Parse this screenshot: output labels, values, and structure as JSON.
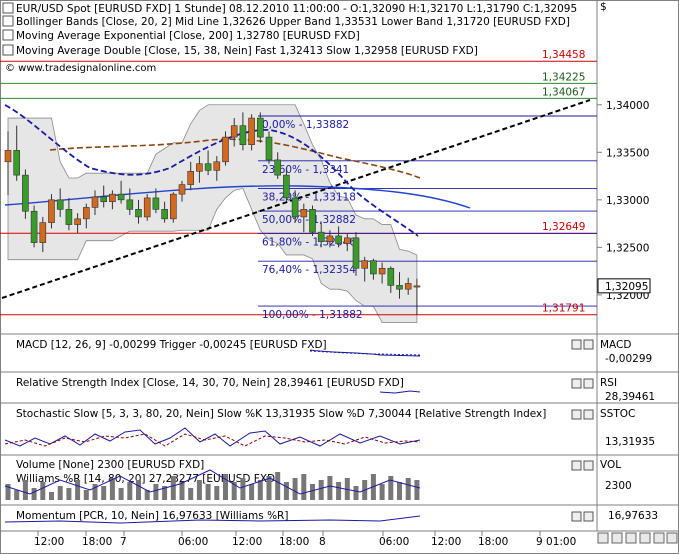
{
  "colors": {
    "bull": "#d2691e",
    "bear": "#3a9a2a",
    "fib": "#1a1aa8",
    "ma_double": "#1a1aa8",
    "ma_slow": "#8b4513",
    "ema200": "#2244cc",
    "trend": "#000000",
    "bands": "#555555",
    "red": "#d10000",
    "green_line": "#2e8b2e",
    "panel_line": "#1a1aa8"
  },
  "header": {
    "title_line": "EUR/USD Spot [EURUSD FXD]  1 Stunde] 08.12.2010 11:00:00 - O:1,32090 H:1,32170 L:1,31790 C:1,32095",
    "bollinger": "Bollinger Bands [Close, 20, 2] Mid Line 1,32626 Upper Band 1,33531 Lower Band 1,31720 [EURUSD FXD]",
    "ema": "Moving Average Exponential [Close, 200] 1,32780 [EURUSD FXD]",
    "ma_double": "Moving Average Double [Close, 15, 38, Nein] Fast 1,32413 Slow 1,32958 [EURUSD FXD]",
    "watermark": "© www.tradesignalonline.com"
  },
  "right_axis": {
    "currency": "$",
    "ticks": [
      "1,34000",
      "1,33500",
      "1,33000",
      "1,32500",
      "1,32000"
    ],
    "tags": [
      {
        "text": "1,34458",
        "kind": "red"
      },
      {
        "text": "1,34225",
        "kind": "green"
      },
      {
        "text": "1,34067",
        "kind": "green"
      },
      {
        "text": "1,32649",
        "kind": "red"
      },
      {
        "text": "1,32095",
        "kind": "last"
      },
      {
        "text": "1,31791",
        "kind": "red"
      }
    ]
  },
  "panels": [
    {
      "label": "MACD [12, 26, 9] -0,00299 Trigger -0,00245 [EURUSD FXD]",
      "axis": "MACD",
      "value": "-0,00299"
    },
    {
      "label": "Relative Strength Index [Close, 14, 30, 70, Nein] 28,39461 [EURUSD FXD]",
      "axis": "RSI",
      "value": "28,39461"
    },
    {
      "label": "Stochastic Slow [5, 3, 3, 80, 20, Nein] Slow %K 13,31935 Slow %D 7,30044 [Relative Strength Index]",
      "axis": "SSTOC",
      "value": "13,31935"
    },
    {
      "label": "Volume [None] 2300 [EURUSD FXD]",
      "label2": "Williams %R [14, 80, 20] 27,23277 [EURUSD FXD]",
      "axis": "VOL",
      "value": "2300"
    },
    {
      "label": "Momentum [PCR, 10, Nein] 16,97633 [Williams %R]",
      "axis": "",
      "value": "16,97633"
    }
  ],
  "x_axis": {
    "labels": [
      "12:00",
      "18:00",
      "7",
      "06:00",
      "12:00",
      "18:00",
      "8",
      "06:00",
      "12:00",
      "18:00",
      "9 01:00"
    ]
  },
  "chart_data": [
    {
      "type": "candlestick",
      "title": "EUR/USD Spot [EURUSD FXD]  1 Stunde]",
      "ylim": [
        1.3162,
        1.3445
      ],
      "grid": false,
      "candles": [
        {
          "o": 1.334,
          "h": 1.3372,
          "l": 1.3305,
          "c": 1.3352
        },
        {
          "o": 1.3352,
          "h": 1.3378,
          "l": 1.332,
          "c": 1.3326
        },
        {
          "o": 1.3326,
          "h": 1.3332,
          "l": 1.328,
          "c": 1.3288
        },
        {
          "o": 1.3288,
          "h": 1.3294,
          "l": 1.325,
          "c": 1.3255
        },
        {
          "o": 1.3255,
          "h": 1.3282,
          "l": 1.3245,
          "c": 1.3276
        },
        {
          "o": 1.3276,
          "h": 1.3306,
          "l": 1.327,
          "c": 1.33
        },
        {
          "o": 1.33,
          "h": 1.3312,
          "l": 1.3282,
          "c": 1.329
        },
        {
          "o": 1.329,
          "h": 1.3302,
          "l": 1.3268,
          "c": 1.3274
        },
        {
          "o": 1.3274,
          "h": 1.3286,
          "l": 1.3265,
          "c": 1.328
        },
        {
          "o": 1.328,
          "h": 1.3296,
          "l": 1.327,
          "c": 1.3292
        },
        {
          "o": 1.3292,
          "h": 1.331,
          "l": 1.3284,
          "c": 1.3303
        },
        {
          "o": 1.3303,
          "h": 1.3315,
          "l": 1.3292,
          "c": 1.3298
        },
        {
          "o": 1.3298,
          "h": 1.331,
          "l": 1.329,
          "c": 1.3306
        },
        {
          "o": 1.3306,
          "h": 1.332,
          "l": 1.3296,
          "c": 1.33
        },
        {
          "o": 1.33,
          "h": 1.3312,
          "l": 1.3284,
          "c": 1.329
        },
        {
          "o": 1.329,
          "h": 1.33,
          "l": 1.3275,
          "c": 1.3282
        },
        {
          "o": 1.3282,
          "h": 1.3306,
          "l": 1.3278,
          "c": 1.3302
        },
        {
          "o": 1.3302,
          "h": 1.3312,
          "l": 1.3286,
          "c": 1.329
        },
        {
          "o": 1.329,
          "h": 1.3298,
          "l": 1.3276,
          "c": 1.328
        },
        {
          "o": 1.328,
          "h": 1.3308,
          "l": 1.3276,
          "c": 1.3306
        },
        {
          "o": 1.3306,
          "h": 1.332,
          "l": 1.3298,
          "c": 1.3316
        },
        {
          "o": 1.3316,
          "h": 1.334,
          "l": 1.331,
          "c": 1.333
        },
        {
          "o": 1.333,
          "h": 1.3346,
          "l": 1.3318,
          "c": 1.3338
        },
        {
          "o": 1.3338,
          "h": 1.3352,
          "l": 1.3326,
          "c": 1.3331
        },
        {
          "o": 1.3331,
          "h": 1.3346,
          "l": 1.332,
          "c": 1.334
        },
        {
          "o": 1.334,
          "h": 1.3372,
          "l": 1.3336,
          "c": 1.3366
        },
        {
          "o": 1.3366,
          "h": 1.3386,
          "l": 1.3356,
          "c": 1.3378
        },
        {
          "o": 1.3378,
          "h": 1.3392,
          "l": 1.3352,
          "c": 1.3358
        },
        {
          "o": 1.3358,
          "h": 1.339,
          "l": 1.3352,
          "c": 1.3386
        },
        {
          "o": 1.3386,
          "h": 1.3392,
          "l": 1.336,
          "c": 1.3366
        },
        {
          "o": 1.3366,
          "h": 1.3372,
          "l": 1.3338,
          "c": 1.3342
        },
        {
          "o": 1.3342,
          "h": 1.335,
          "l": 1.3322,
          "c": 1.3326
        },
        {
          "o": 1.3326,
          "h": 1.3334,
          "l": 1.3298,
          "c": 1.3302
        },
        {
          "o": 1.3302,
          "h": 1.331,
          "l": 1.3276,
          "c": 1.3282
        },
        {
          "o": 1.3282,
          "h": 1.3296,
          "l": 1.3266,
          "c": 1.329
        },
        {
          "o": 1.329,
          "h": 1.3294,
          "l": 1.3262,
          "c": 1.3266
        },
        {
          "o": 1.3266,
          "h": 1.3276,
          "l": 1.325,
          "c": 1.3256
        },
        {
          "o": 1.3256,
          "h": 1.3268,
          "l": 1.325,
          "c": 1.3262
        },
        {
          "o": 1.3262,
          "h": 1.3272,
          "l": 1.325,
          "c": 1.3254
        },
        {
          "o": 1.3254,
          "h": 1.3264,
          "l": 1.3246,
          "c": 1.326
        },
        {
          "o": 1.326,
          "h": 1.3266,
          "l": 1.322,
          "c": 1.3228
        },
        {
          "o": 1.3228,
          "h": 1.324,
          "l": 1.3214,
          "c": 1.3236
        },
        {
          "o": 1.3236,
          "h": 1.3238,
          "l": 1.3216,
          "c": 1.3222
        },
        {
          "o": 1.3222,
          "h": 1.3234,
          "l": 1.3212,
          "c": 1.3228
        },
        {
          "o": 1.3228,
          "h": 1.323,
          "l": 1.3202,
          "c": 1.321
        },
        {
          "o": 1.321,
          "h": 1.3224,
          "l": 1.3196,
          "c": 1.3206
        },
        {
          "o": 1.3206,
          "h": 1.3218,
          "l": 1.32,
          "c": 1.3212
        },
        {
          "o": 1.3209,
          "h": 1.3217,
          "l": 1.3179,
          "c": 1.32095
        }
      ],
      "fibonacci": [
        {
          "label": "0,00% - 1,33882",
          "value": 1.33882
        },
        {
          "label": "23,60% - 1,3341",
          "value": 1.3341
        },
        {
          "label": "38,20% - 1,33118",
          "value": 1.33118
        },
        {
          "label": "50,00% - 1,32882",
          "value": 1.32882
        },
        {
          "label": "61,80% - 1,32646",
          "value": 1.32646
        },
        {
          "label": "76,40% - 1,32354",
          "value": 1.32354
        },
        {
          "label": "100,00% - 1,31882",
          "value": 1.31882
        }
      ],
      "horizontal_lines": [
        {
          "value": 1.34458,
          "kind": "red"
        },
        {
          "value": 1.34225,
          "kind": "green"
        },
        {
          "value": 1.34067,
          "kind": "green"
        },
        {
          "value": 1.32649,
          "kind": "red"
        },
        {
          "value": 1.31791,
          "kind": "red"
        }
      ]
    }
  ]
}
